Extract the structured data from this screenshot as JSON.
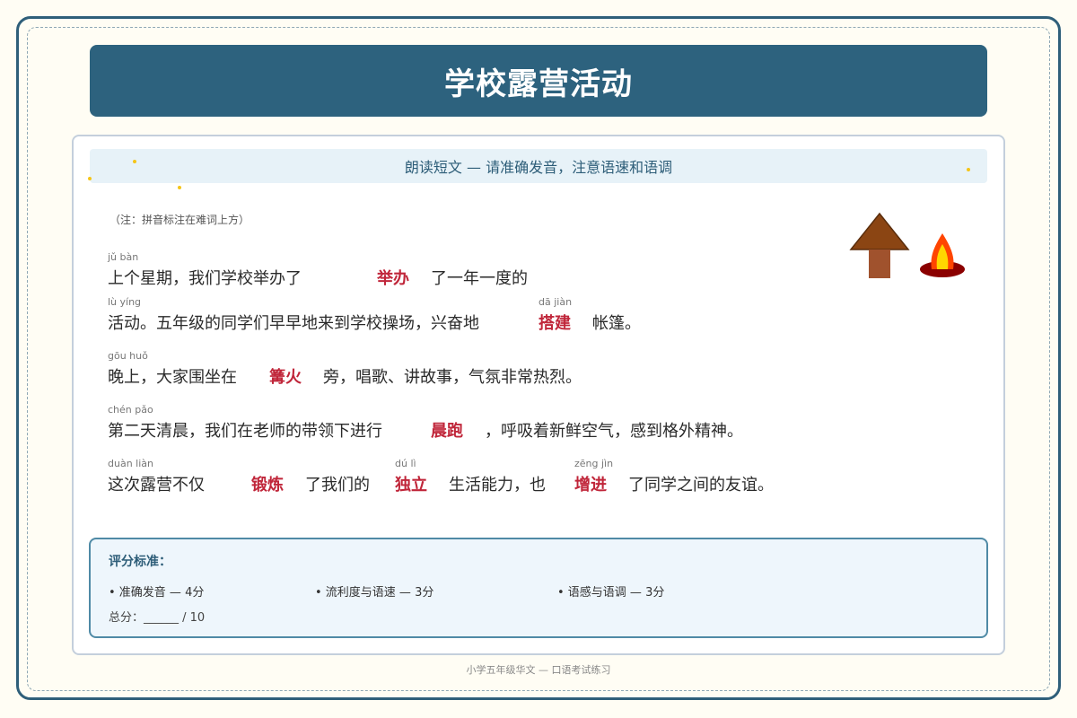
{
  "title": "学校露营活动",
  "instruction": "朗读短文 — 请准确发音，注意语速和语调",
  "note": "（注：拼音标注在难词上方）",
  "lines": [
    {
      "before": "上个星期，我们学校举办了",
      "word": "举办",
      "pinyin": "jǔ bàn",
      "after": "了一年一度的"
    },
    {
      "before": "活动。五年级的同学们早早地来到学校操场，兴奋地",
      "pinyin_before": "lù yíng",
      "word": "搭建",
      "pinyin": "dā jiàn",
      "after": "帐篷。"
    },
    {
      "before": "晚上，大家围坐在",
      "word": "篝火",
      "pinyin": "gōu huǒ",
      "after": "旁，唱歌、讲故事，气氛非常热烈。"
    },
    {
      "before": "第二天清晨，我们在老师的带领下进行",
      "word": "晨跑",
      "pinyin": "chén pǎo",
      "after": "，呼吸着新鲜空气，感到格外精神。"
    },
    {
      "before": "这次露营不仅",
      "word": "锻炼",
      "pinyin": "duàn liàn",
      "middle": "了我们的",
      "word2": "独立",
      "pinyin2": "dú lì",
      "middle2": "生活能力，也",
      "word3": "增进",
      "pinyin3": "zēng jìn",
      "after": "了同学之间的友谊。"
    }
  ],
  "criteria": {
    "title": "评分标准：",
    "items": [
      "• 准确发音 — 4分",
      "• 流利度与语速 — 3分",
      "• 语感与语调 — 3分"
    ],
    "score": "总分：______ / 10"
  },
  "footer": "小学五年级华文 — 口语考试练习",
  "icons": {
    "tent": "tent-icon",
    "campfire": "campfire-icon"
  },
  "colors": {
    "accent": "#2d627e",
    "keyword": "#c0263a"
  }
}
